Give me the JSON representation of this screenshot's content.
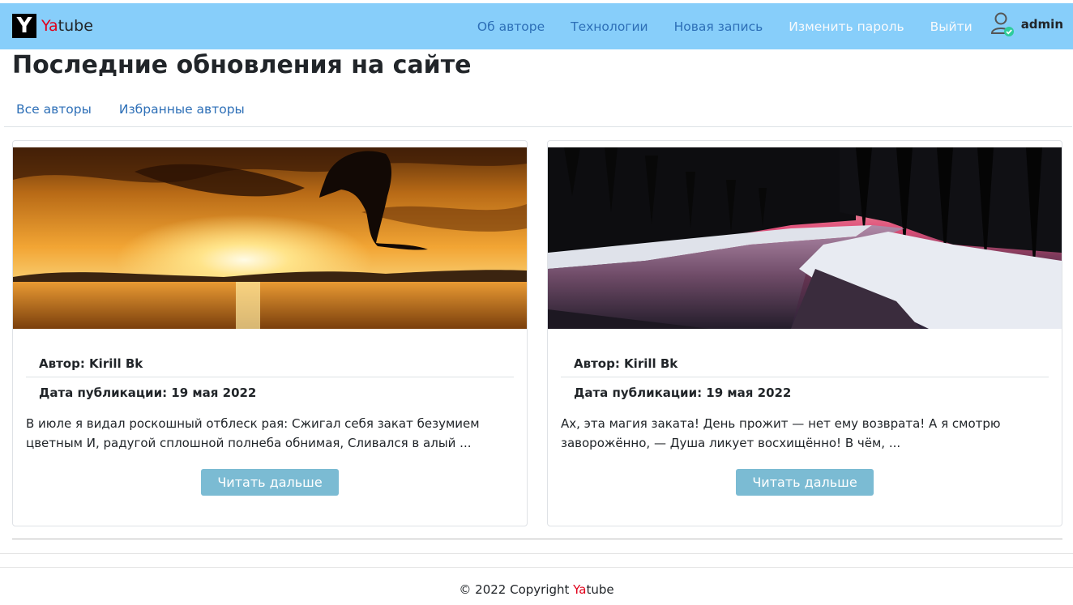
{
  "navbar": {
    "brand": {
      "logo_letter": "Y",
      "ya": "Ya",
      "tube": "tube"
    },
    "links": [
      {
        "label": "Об авторе"
      },
      {
        "label": "Технологии"
      },
      {
        "label": "Новая запись"
      },
      {
        "label": "Изменить пароль"
      },
      {
        "label": "Выйти"
      }
    ],
    "user": {
      "name": "admin"
    }
  },
  "page": {
    "title": "Последние обновления на сайте"
  },
  "tabs": [
    {
      "label": "Все авторы"
    },
    {
      "label": "Избранные авторы"
    }
  ],
  "posts": [
    {
      "image": "sunset-dolphin",
      "author": "Автор: Kirill Bk",
      "date": "Дата публикации: 19 мая 2022",
      "excerpt": "В июле я видал роскошный отблеск рая: Сжигал себя закат безумием цветным И, радугой сплошной полнеба обнимая, Сливался в алый ...",
      "button": "Читать дальше"
    },
    {
      "image": "winter-river-sunset",
      "author": "Автор: Kirill Bk",
      "date": "Дата публикации: 19 мая 2022",
      "excerpt": "Ах, эта магия заката! День прожит — нет ему возврата! А я смотрю заворожённо, — Душа ликует восхищённо! В чём, ...",
      "button": "Читать дальше"
    }
  ],
  "footer": {
    "copyright": "© 2022 Copyright ",
    "ya": "Ya",
    "tube": "tube"
  },
  "colors": {
    "navbar_bg": "#87cefa",
    "brand_red": "#e0001a",
    "link_blue": "#2d6fb7",
    "button_bg": "#7bbbd3"
  }
}
